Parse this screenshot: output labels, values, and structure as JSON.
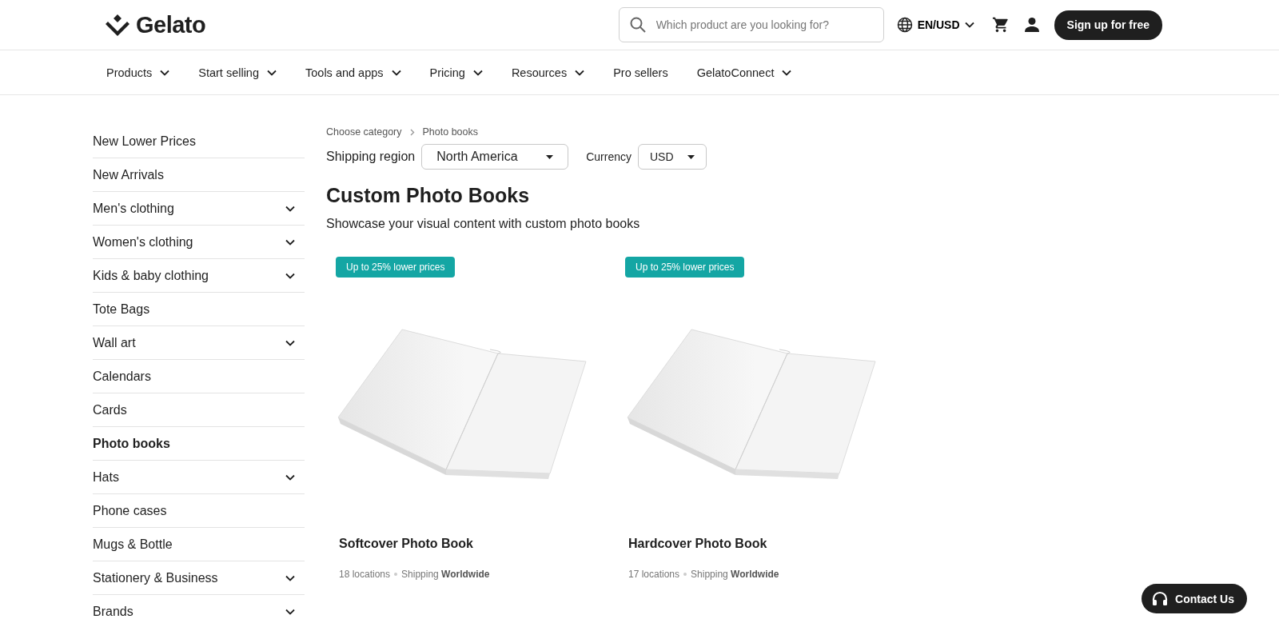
{
  "header": {
    "logo": "Gelato",
    "search": {
      "placeholder": "Which product are you looking for?"
    },
    "locale": "EN/USD",
    "signup": "Sign up for free"
  },
  "nav": [
    {
      "label": "Products",
      "has_menu": true
    },
    {
      "label": "Start selling",
      "has_menu": true
    },
    {
      "label": "Tools and apps",
      "has_menu": true
    },
    {
      "label": "Pricing",
      "has_menu": true
    },
    {
      "label": "Resources",
      "has_menu": true
    },
    {
      "label": "Pro sellers",
      "has_menu": false
    },
    {
      "label": "GelatoConnect",
      "has_menu": true
    }
  ],
  "sidebar": {
    "items": [
      {
        "label": "New Lower Prices",
        "expandable": false,
        "selected": false
      },
      {
        "label": "New Arrivals",
        "expandable": false,
        "selected": false
      },
      {
        "label": "Men's clothing",
        "expandable": true,
        "selected": false
      },
      {
        "label": "Women's clothing",
        "expandable": true,
        "selected": false
      },
      {
        "label": "Kids & baby clothing",
        "expandable": true,
        "selected": false
      },
      {
        "label": "Tote Bags",
        "expandable": false,
        "selected": false
      },
      {
        "label": "Wall art",
        "expandable": true,
        "selected": false
      },
      {
        "label": "Calendars",
        "expandable": false,
        "selected": false
      },
      {
        "label": "Cards",
        "expandable": false,
        "selected": false
      },
      {
        "label": "Photo books",
        "expandable": false,
        "selected": true
      },
      {
        "label": "Hats",
        "expandable": true,
        "selected": false
      },
      {
        "label": "Phone cases",
        "expandable": false,
        "selected": false
      },
      {
        "label": "Mugs & Bottle",
        "expandable": false,
        "selected": false
      },
      {
        "label": "Stationery & Business",
        "expandable": true,
        "selected": false
      },
      {
        "label": "Brands",
        "expandable": true,
        "selected": false
      }
    ]
  },
  "breadcrumb": [
    "Choose category",
    "Photo books"
  ],
  "filters": [
    {
      "label": "Shipping region",
      "value": "North America"
    },
    {
      "label": "Currency",
      "value": "USD"
    }
  ],
  "title": "Custom Photo Books",
  "subtitle": "Showcase your visual content with custom photo books",
  "products": [
    {
      "badge": "Up to 25% lower prices",
      "name": "Softcover Photo Book",
      "locations": "18 locations",
      "shipping": "Shipping **Worldwide**"
    },
    {
      "badge": "Up to 25% lower prices",
      "name": "Hardcover Photo Book",
      "locations": "17 locations",
      "shipping": "Shipping **Worldwide**"
    }
  ],
  "contact": "Contact Us"
}
